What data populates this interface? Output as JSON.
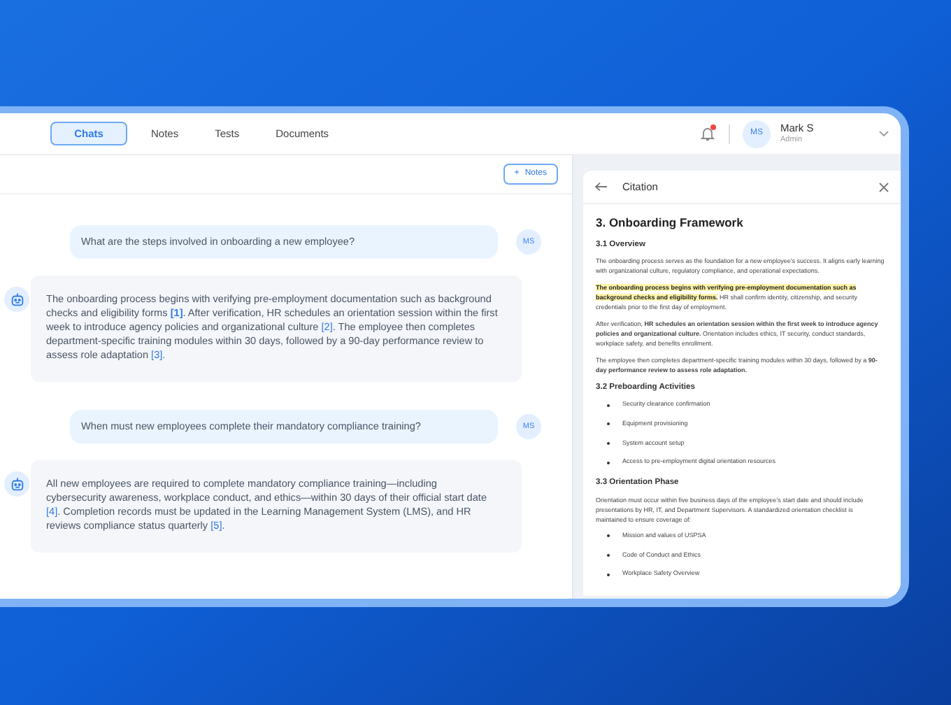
{
  "tabs": [
    {
      "label": "Chats",
      "selected": true
    },
    {
      "label": "Notes",
      "selected": false
    },
    {
      "label": "Tests",
      "selected": false
    },
    {
      "label": "Documents",
      "selected": false
    }
  ],
  "notifications": {
    "unread": true
  },
  "user": {
    "initials": "MS",
    "name": "Mark S",
    "role": "Admin"
  },
  "notes_button": {
    "icon": "+",
    "label": "Notes"
  },
  "messages": [
    {
      "kind": "user",
      "avatar": "MS",
      "parts": [
        {
          "kind": "text",
          "text": "What are the steps involved in onboarding a new employee?"
        }
      ]
    },
    {
      "kind": "bot",
      "parts": [
        {
          "kind": "text",
          "text": "The onboarding process begins with verifying pre-employment documentation such as background checks and eligibility forms "
        },
        {
          "kind": "citation",
          "text": "[1]",
          "selected": true
        },
        {
          "kind": "text",
          "text": ". After verification, HR schedules an orientation session within the first week to introduce agency policies and organizational culture "
        },
        {
          "kind": "citation",
          "text": "[2]",
          "selected": false
        },
        {
          "kind": "text",
          "text": ". The employee then completes department-specific training modules within 30 days, followed by a 90-day performance review to assess role adaptation "
        },
        {
          "kind": "citation",
          "text": "[3]",
          "selected": false
        },
        {
          "kind": "text",
          "text": "."
        }
      ]
    },
    {
      "kind": "user",
      "avatar": "MS",
      "parts": [
        {
          "kind": "text",
          "text": "When must new employees complete their mandatory compliance training?"
        }
      ]
    },
    {
      "kind": "bot",
      "parts": [
        {
          "kind": "text",
          "text": "All new employees are required to complete mandatory compliance training—including cybersecurity awareness, workplace conduct, and ethics—within 30 days of their official start date "
        },
        {
          "kind": "citation",
          "text": "[4]",
          "selected": false
        },
        {
          "kind": "text",
          "text": ". Completion records must be updated in the Learning Management System (LMS), and HR reviews compliance status quarterly "
        },
        {
          "kind": "citation",
          "text": "[5]",
          "selected": false
        },
        {
          "kind": "text",
          "text": "."
        }
      ]
    }
  ],
  "citation": {
    "title": "Citation",
    "document": [
      {
        "kind": "heading",
        "text": "3. Onboarding Framework"
      },
      {
        "kind": "subheading",
        "text": "3.1 Overview"
      },
      {
        "kind": "paragraph",
        "text": "The onboarding process serves as the foundation for a new employee's success. It aligns early learning with organizational culture, regulatory compliance, and operational expectations."
      },
      {
        "kind": "paragraph",
        "highlight": "The onboarding process begins with verifying pre-employment documentation such as background checks and eligibility forms.",
        "text": " HR shall confirm identity, citizenship, and security credentials prior to the first day of employment."
      },
      {
        "kind": "paragraph",
        "text": "After verification, **HR schedules an orientation session within the first week to introduce agency policies and organizational culture.** Orientation includes ethics, IT security, conduct standards, workplace safety, and benefits enrollment."
      },
      {
        "kind": "paragraph",
        "text": "The employee then completes department-specific training modules within 30 days, followed by a **90-day performance review to assess role adaptation.**"
      },
      {
        "kind": "subheading",
        "text": "3.2 Preboarding Activities"
      },
      {
        "kind": "bullet",
        "text": "Security clearance confirmation"
      },
      {
        "kind": "bullet",
        "text": "Equipment provisioning"
      },
      {
        "kind": "bullet",
        "text": "System account setup"
      },
      {
        "kind": "bullet",
        "text": "Access to pre-employment digital orientation resources"
      },
      {
        "kind": "subheading",
        "text": "3.3 Orientation Phase"
      },
      {
        "kind": "paragraph",
        "text": "Orientation must occur within five business days of the employee's start date and should include presentations by HR, IT, and Department Supervisors. A standardized orientation checklist is maintained to ensure coverage of:"
      },
      {
        "kind": "bullet",
        "text": "Mission and values of USPSA"
      },
      {
        "kind": "bullet",
        "text": "Code of Conduct and Ethics"
      },
      {
        "kind": "bullet",
        "text": "Workplace Safety Overview"
      }
    ]
  }
}
